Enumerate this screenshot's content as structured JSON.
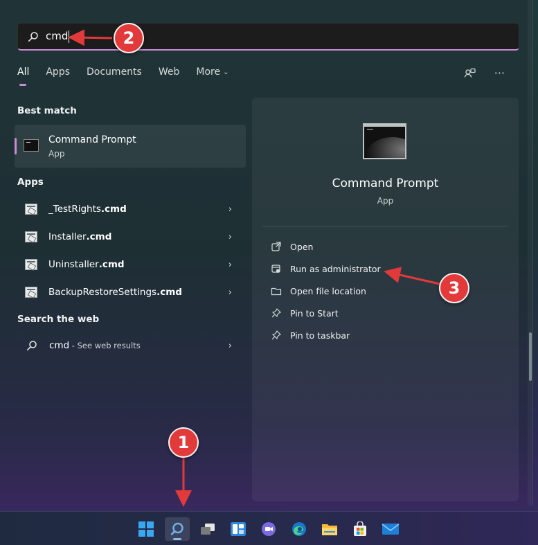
{
  "search": {
    "query": "cmd"
  },
  "tabs": [
    {
      "label": "All",
      "active": true
    },
    {
      "label": "Apps"
    },
    {
      "label": "Documents"
    },
    {
      "label": "Web"
    },
    {
      "label": "More"
    }
  ],
  "sections": {
    "best_match": "Best match",
    "apps": "Apps",
    "search_web": "Search the web"
  },
  "best_match": {
    "title": "Command Prompt",
    "subtitle": "App"
  },
  "apps": [
    {
      "prefix": "_TestRights",
      "ext": ".cmd"
    },
    {
      "prefix": "Installer",
      "ext": ".cmd"
    },
    {
      "prefix": "Uninstaller",
      "ext": ".cmd"
    },
    {
      "prefix": "BackupRestoreSettings",
      "ext": ".cmd"
    }
  ],
  "web": {
    "query": "cmd",
    "suffix": " - See web results"
  },
  "preview": {
    "title": "Command Prompt",
    "subtitle": "App",
    "actions": [
      {
        "label": "Open",
        "icon": "open-external-icon"
      },
      {
        "label": "Run as administrator",
        "icon": "shield-admin-icon"
      },
      {
        "label": "Open file location",
        "icon": "folder-icon"
      },
      {
        "label": "Pin to Start",
        "icon": "pin-icon"
      },
      {
        "label": "Pin to taskbar",
        "icon": "pin-icon"
      }
    ]
  },
  "annotations": {
    "one": "1",
    "two": "2",
    "three": "3"
  },
  "colors": {
    "accent": "#c98bd6",
    "badge": "#e23a3a",
    "windows_blue": "#39a8f0"
  }
}
